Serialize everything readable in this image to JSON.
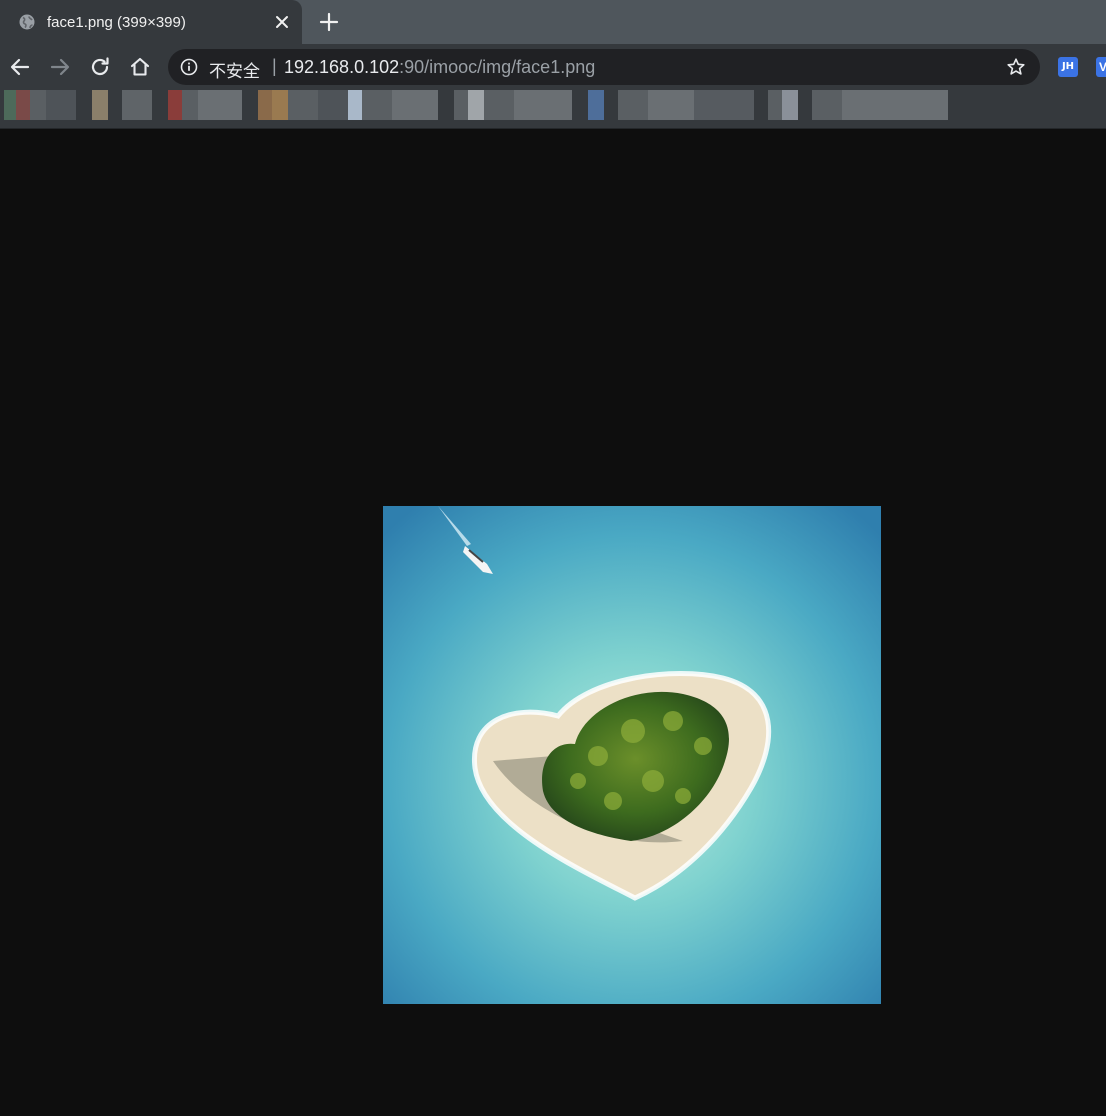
{
  "tab": {
    "title": "face1.png (399×399)",
    "favicon": "globe-icon",
    "close_icon": "close-icon"
  },
  "new_tab_icon": "plus-icon",
  "toolbar": {
    "back_icon": "arrow-left-icon",
    "forward_icon": "arrow-right-icon",
    "reload_icon": "reload-icon",
    "home_icon": "home-icon",
    "security_label": "不安全",
    "url_host": "192.168.0.102",
    "url_rest": ":90/imooc/img/face1.png",
    "bookmark_star_icon": "star-icon"
  },
  "extensions": [
    {
      "name": "jh-extension-icon",
      "label": "JH"
    },
    {
      "name": "v-extension-icon",
      "label": "V"
    }
  ],
  "colors": {
    "tabstrip_bg": "#4f565c",
    "toolbar_bg": "#35393d",
    "omnibox_bg": "#202124",
    "page_bg": "#0e0e0e",
    "extension_blue": "#3b73e5"
  },
  "content": {
    "image_description_icon": "heart-island-photo"
  }
}
